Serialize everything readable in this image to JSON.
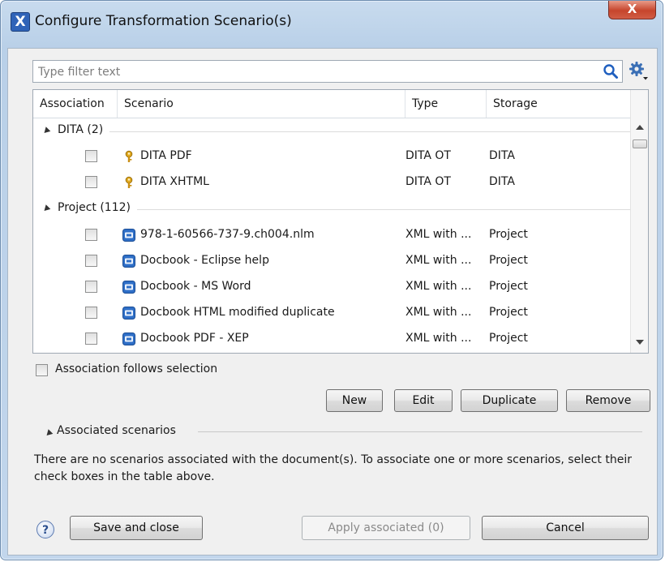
{
  "window": {
    "title": "Configure Transformation Scenario(s)",
    "close_label": "X",
    "app_icon_label": "X"
  },
  "filter": {
    "placeholder": "Type filter text",
    "value": ""
  },
  "table": {
    "columns": [
      "Association",
      "Scenario",
      "Type",
      "Storage"
    ],
    "groups": [
      {
        "label": "DITA (2)",
        "rows": [
          {
            "name": "DITA PDF",
            "type": "DITA OT",
            "storage": "DITA",
            "icon": "key-icon"
          },
          {
            "name": "DITA XHTML",
            "type": "DITA OT",
            "storage": "DITA",
            "icon": "key-icon"
          }
        ]
      },
      {
        "label": "Project (112)",
        "rows": [
          {
            "name": "978-1-60566-737-9.ch004.nlm",
            "type": "XML with ...",
            "storage": "Project",
            "icon": "scenario-icon"
          },
          {
            "name": "Docbook - Eclipse help",
            "type": "XML with ...",
            "storage": "Project",
            "icon": "scenario-icon"
          },
          {
            "name": "Docbook - MS Word",
            "type": "XML with ...",
            "storage": "Project",
            "icon": "scenario-icon"
          },
          {
            "name": "Docbook HTML modified duplicate",
            "type": "XML with ...",
            "storage": "Project",
            "icon": "scenario-icon"
          },
          {
            "name": "Docbook PDF - XEP",
            "type": "XML with ...",
            "storage": "Project",
            "icon": "scenario-icon"
          }
        ]
      }
    ]
  },
  "association_follows_selection": {
    "label": "Association follows selection",
    "checked": false
  },
  "actions": {
    "new": "New",
    "edit": "Edit",
    "duplicate": "Duplicate",
    "remove": "Remove"
  },
  "associated": {
    "header": "Associated scenarios",
    "message": "There are no scenarios associated with the document(s). To associate one or more scenarios, select their check boxes in the table above."
  },
  "footer": {
    "help": "?",
    "save_and_close": "Save and close",
    "apply_associated": "Apply associated (0)",
    "cancel": "Cancel"
  },
  "colors": {
    "title_bar": "#b9d0e8",
    "close_button": "#c6452c",
    "dialog_bg": "#f0f0f0",
    "scenario_icon": "#2f6fc7",
    "key_icon": "#d9a21b"
  }
}
